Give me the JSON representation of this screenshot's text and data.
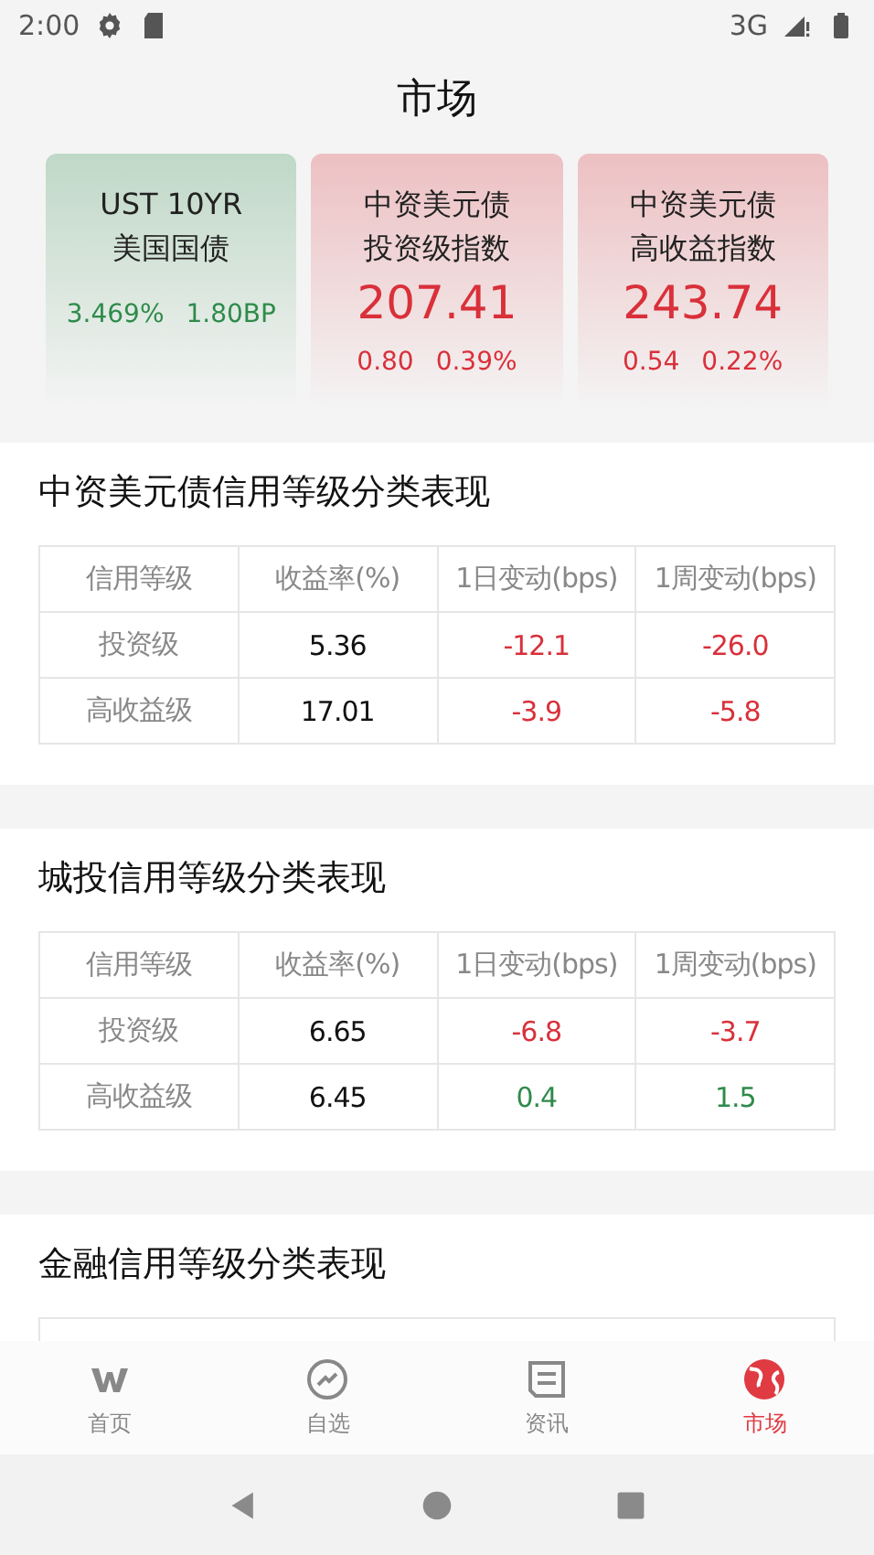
{
  "status_bar": {
    "time": "2:00",
    "network": "3G"
  },
  "title": "市场",
  "cards": [
    {
      "name_lines": [
        "UST 10YR",
        "美国国债"
      ],
      "changes": [
        "3.469%",
        "1.80BP"
      ],
      "color": "#2e8b4a"
    },
    {
      "name_lines": [
        "中资美元债",
        "投资级指数"
      ],
      "value": "207.41",
      "changes": [
        "0.80",
        "0.39%"
      ],
      "color": "#d9303a"
    },
    {
      "name_lines": [
        "中资美元债",
        "高收益指数"
      ],
      "value": "243.74",
      "changes": [
        "0.54",
        "0.22%"
      ],
      "color": "#d9303a"
    }
  ],
  "sections": [
    {
      "title": "中资美元债信用等级分类表现",
      "columns": [
        "信用等级",
        "收益率(%)",
        "1日变动(bps)",
        "1周变动(bps)"
      ],
      "rows": [
        {
          "grade": "投资级",
          "yield": "5.36",
          "changes": [
            {
              "text": "-12.1",
              "color": "#d9303a"
            },
            {
              "text": "-26.0",
              "color": "#d9303a"
            }
          ]
        },
        {
          "grade": "高收益级",
          "yield": "17.01",
          "changes": [
            {
              "text": "-3.9",
              "color": "#d9303a"
            },
            {
              "text": "-5.8",
              "color": "#d9303a"
            }
          ]
        }
      ]
    },
    {
      "title": "城投信用等级分类表现",
      "columns": [
        "信用等级",
        "收益率(%)",
        "1日变动(bps)",
        "1周变动(bps)"
      ],
      "rows": [
        {
          "grade": "投资级",
          "yield": "6.65",
          "changes": [
            {
              "text": "-6.8",
              "color": "#d9303a"
            },
            {
              "text": "-3.7",
              "color": "#d9303a"
            }
          ]
        },
        {
          "grade": "高收益级",
          "yield": "6.45",
          "changes": [
            {
              "text": "0.4",
              "color": "#2e8b4a"
            },
            {
              "text": "1.5",
              "color": "#2e8b4a"
            }
          ]
        }
      ]
    },
    {
      "title": "金融信用等级分类表现"
    }
  ],
  "nav": [
    {
      "kind": "home",
      "label": "首页",
      "selected": false
    },
    {
      "kind": "watchlist",
      "label": "自选",
      "selected": false
    },
    {
      "kind": "news",
      "label": "资讯",
      "selected": false
    },
    {
      "kind": "market",
      "label": "市场",
      "selected": true
    }
  ]
}
